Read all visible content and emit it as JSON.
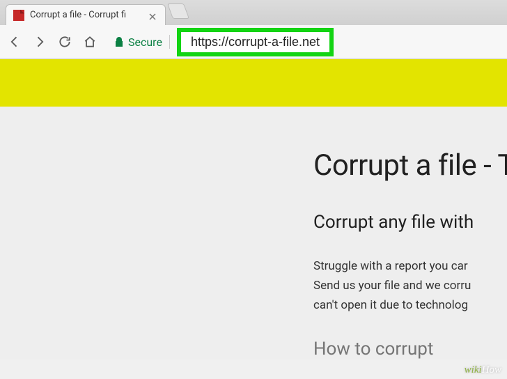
{
  "browser": {
    "tab": {
      "title": "Corrupt a file - Corrupt fi"
    },
    "secure_label": "Secure",
    "url": "https://corrupt-a-file.net"
  },
  "page": {
    "heading": "Corrupt a file - T",
    "subheading": "Corrupt any file with",
    "paragraph_l1": "Struggle with a report you car",
    "paragraph_l2": "Send us your file and we corru",
    "paragraph_l3": "can't open it due to technolog",
    "cut_heading": "How to corrupt"
  },
  "watermark": {
    "prefix": "wiki",
    "suffix": "How"
  }
}
